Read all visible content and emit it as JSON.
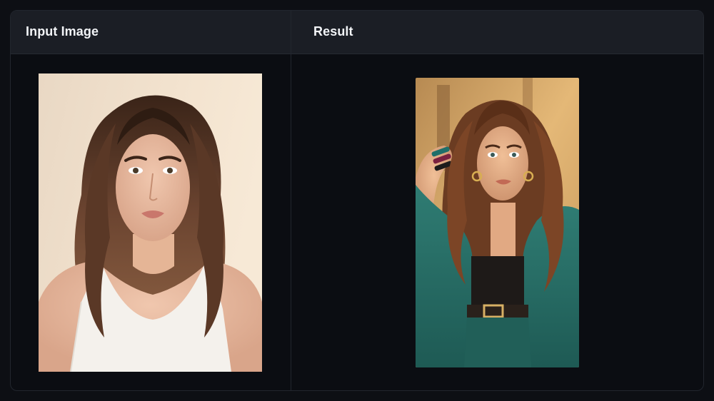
{
  "panels": {
    "input": {
      "title": "Input Image",
      "image": "portrait-input-photo"
    },
    "result": {
      "title": "Result",
      "image": "portrait-result-stylized"
    }
  },
  "colors": {
    "page_bg": "#0d0f14",
    "panel_bg": "#0b0d12",
    "header_bg": "#1b1e25",
    "border": "#22262e",
    "title_text": "#f2f4f7"
  }
}
